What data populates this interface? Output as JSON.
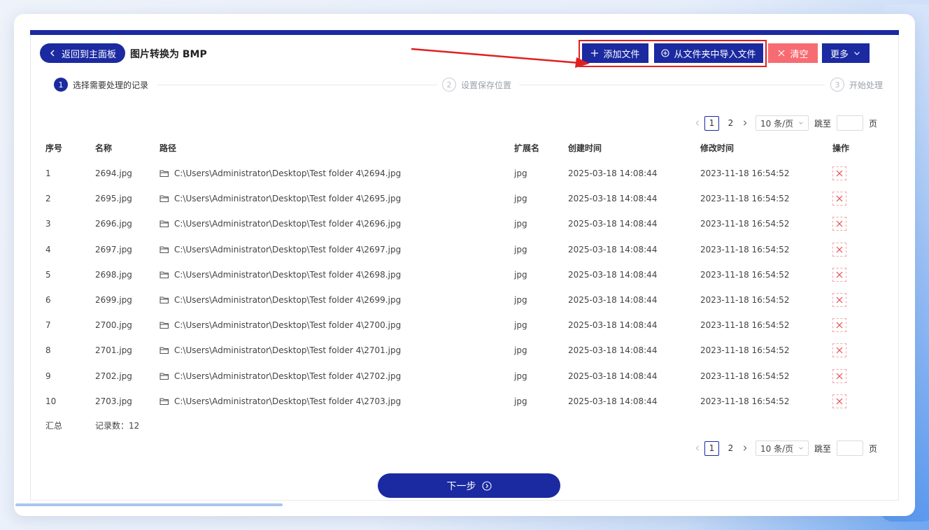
{
  "header": {
    "back_label": "返回到主面板",
    "title": "图片转换为 BMP"
  },
  "toolbar": {
    "add_label": "添加文件",
    "import_label": "从文件夹中导入文件",
    "clear_label": "清空",
    "more_label": "更多"
  },
  "steps": [
    {
      "num": "1",
      "label": "选择需要处理的记录"
    },
    {
      "num": "2",
      "label": "设置保存位置"
    },
    {
      "num": "3",
      "label": "开始处理"
    }
  ],
  "pagination": {
    "pages": [
      "1",
      "2"
    ],
    "page_size": "10 条/页",
    "jump_label": "跳至",
    "page_unit": "页"
  },
  "table": {
    "columns": [
      "序号",
      "名称",
      "路径",
      "扩展名",
      "创建时间",
      "修改时间",
      "操作"
    ],
    "rows": [
      {
        "idx": "1",
        "name": "2694.jpg",
        "path": "C:\\Users\\Administrator\\Desktop\\Test folder 4\\2694.jpg",
        "ext": "jpg",
        "created": "2025-03-18 14:08:44",
        "modified": "2023-11-18 16:54:52"
      },
      {
        "idx": "2",
        "name": "2695.jpg",
        "path": "C:\\Users\\Administrator\\Desktop\\Test folder 4\\2695.jpg",
        "ext": "jpg",
        "created": "2025-03-18 14:08:44",
        "modified": "2023-11-18 16:54:52"
      },
      {
        "idx": "3",
        "name": "2696.jpg",
        "path": "C:\\Users\\Administrator\\Desktop\\Test folder 4\\2696.jpg",
        "ext": "jpg",
        "created": "2025-03-18 14:08:44",
        "modified": "2023-11-18 16:54:52"
      },
      {
        "idx": "4",
        "name": "2697.jpg",
        "path": "C:\\Users\\Administrator\\Desktop\\Test folder 4\\2697.jpg",
        "ext": "jpg",
        "created": "2025-03-18 14:08:44",
        "modified": "2023-11-18 16:54:52"
      },
      {
        "idx": "5",
        "name": "2698.jpg",
        "path": "C:\\Users\\Administrator\\Desktop\\Test folder 4\\2698.jpg",
        "ext": "jpg",
        "created": "2025-03-18 14:08:44",
        "modified": "2023-11-18 16:54:52"
      },
      {
        "idx": "6",
        "name": "2699.jpg",
        "path": "C:\\Users\\Administrator\\Desktop\\Test folder 4\\2699.jpg",
        "ext": "jpg",
        "created": "2025-03-18 14:08:44",
        "modified": "2023-11-18 16:54:52"
      },
      {
        "idx": "7",
        "name": "2700.jpg",
        "path": "C:\\Users\\Administrator\\Desktop\\Test folder 4\\2700.jpg",
        "ext": "jpg",
        "created": "2025-03-18 14:08:44",
        "modified": "2023-11-18 16:54:52"
      },
      {
        "idx": "8",
        "name": "2701.jpg",
        "path": "C:\\Users\\Administrator\\Desktop\\Test folder 4\\2701.jpg",
        "ext": "jpg",
        "created": "2025-03-18 14:08:44",
        "modified": "2023-11-18 16:54:52"
      },
      {
        "idx": "9",
        "name": "2702.jpg",
        "path": "C:\\Users\\Administrator\\Desktop\\Test folder 4\\2702.jpg",
        "ext": "jpg",
        "created": "2025-03-18 14:08:44",
        "modified": "2023-11-18 16:54:52"
      },
      {
        "idx": "10",
        "name": "2703.jpg",
        "path": "C:\\Users\\Administrator\\Desktop\\Test folder 4\\2703.jpg",
        "ext": "jpg",
        "created": "2025-03-18 14:08:44",
        "modified": "2023-11-18 16:54:52"
      }
    ],
    "summary_label": "汇总",
    "summary_count": "记录数：12"
  },
  "footer": {
    "next_label": "下一步"
  },
  "colors": {
    "primary": "#1b2aa0",
    "danger": "#f76c72",
    "highlight": "#e02020"
  },
  "icons": {
    "back": "chevron-left-icon",
    "add": "plus-icon",
    "import": "plus-circle-icon",
    "clear": "close-icon",
    "more": "chevron-down-icon",
    "path": "folder-icon",
    "delete": "close-icon",
    "next": "arrow-circle-right-icon"
  }
}
